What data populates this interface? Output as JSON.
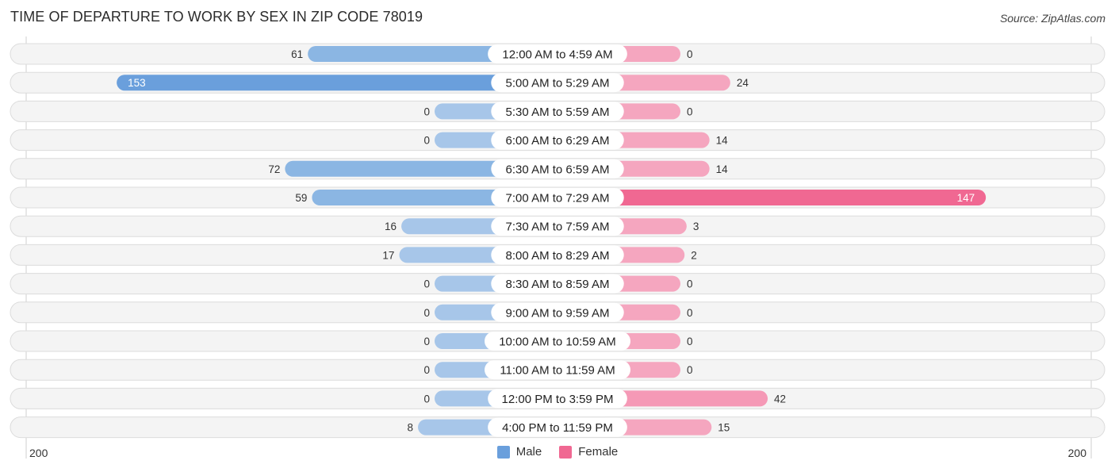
{
  "title": "TIME OF DEPARTURE TO WORK BY SEX IN ZIP CODE 78019",
  "source": "Source: ZipAtlas.com",
  "colors": {
    "male": "#6a9fdc",
    "male_light": "#a7c6e9",
    "female": "#f06892",
    "female_light": "#f5a6bf"
  },
  "legend": [
    {
      "name": "Male",
      "color": "#6a9fdc"
    },
    {
      "name": "Female",
      "color": "#f06892"
    }
  ],
  "chart_data": {
    "type": "bar",
    "orientation": "horizontal-diverging",
    "title": "TIME OF DEPARTURE TO WORK BY SEX IN ZIP CODE 78019",
    "categories": [
      "12:00 AM to 4:59 AM",
      "5:00 AM to 5:29 AM",
      "5:30 AM to 5:59 AM",
      "6:00 AM to 6:29 AM",
      "6:30 AM to 6:59 AM",
      "7:00 AM to 7:29 AM",
      "7:30 AM to 7:59 AM",
      "8:00 AM to 8:29 AM",
      "8:30 AM to 8:59 AM",
      "9:00 AM to 9:59 AM",
      "10:00 AM to 10:59 AM",
      "11:00 AM to 11:59 AM",
      "12:00 PM to 3:59 PM",
      "4:00 PM to 11:59 PM"
    ],
    "series": [
      {
        "name": "Male",
        "values": [
          61,
          153,
          0,
          0,
          72,
          59,
          16,
          17,
          0,
          0,
          0,
          0,
          0,
          8
        ]
      },
      {
        "name": "Female",
        "values": [
          0,
          24,
          0,
          14,
          14,
          147,
          3,
          2,
          0,
          0,
          0,
          0,
          42,
          15
        ]
      }
    ],
    "axis": {
      "left_label": "200",
      "right_label": "200",
      "range": [
        0,
        200
      ]
    },
    "legend_position": "bottom-center",
    "grid": false
  }
}
